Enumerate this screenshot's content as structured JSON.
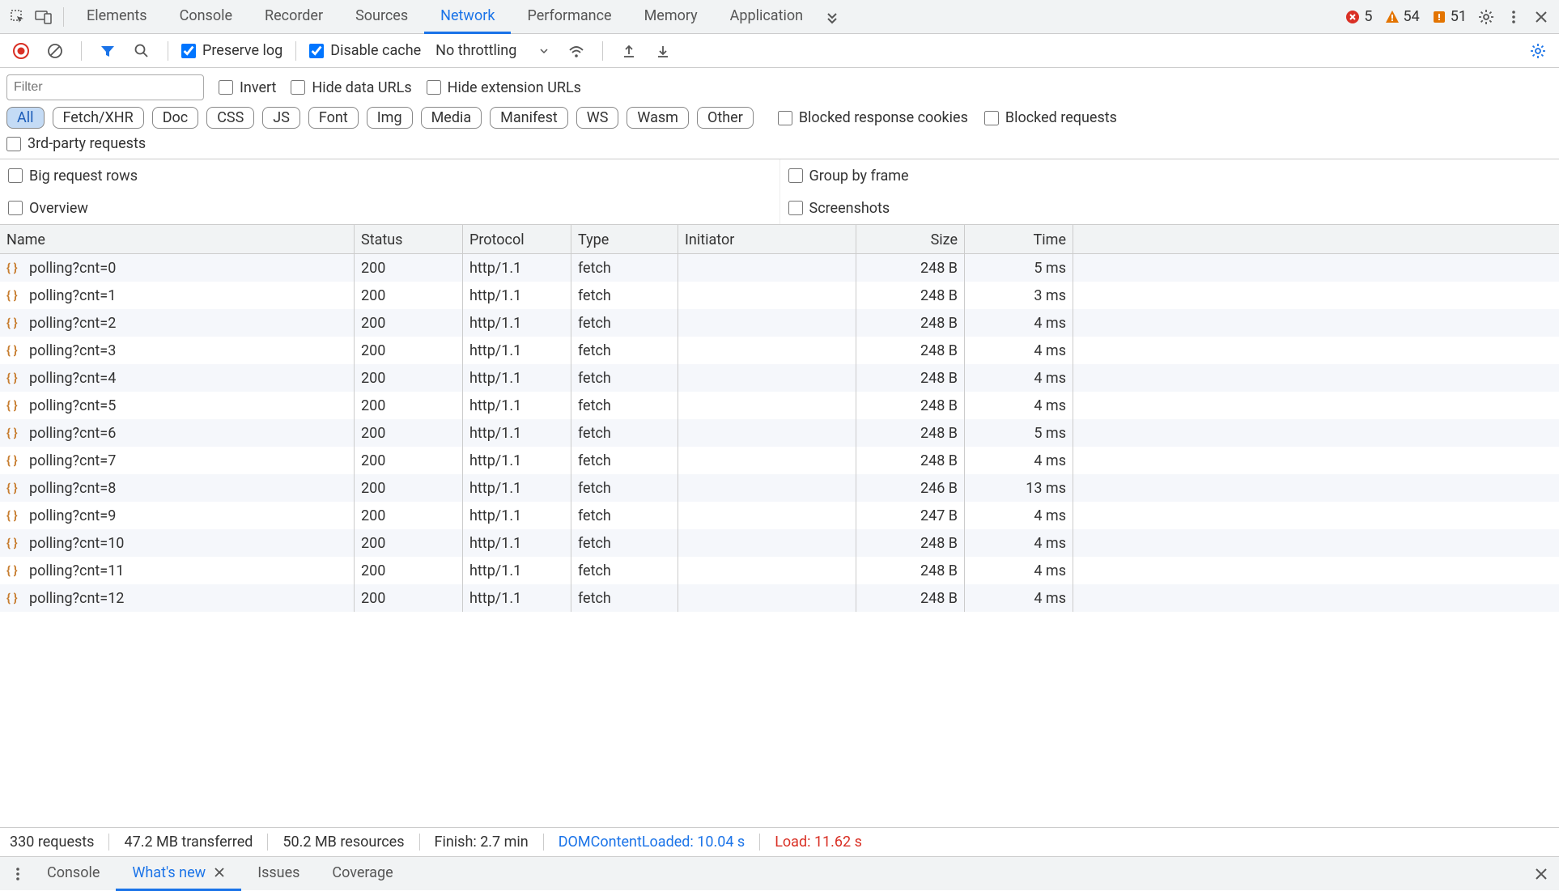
{
  "topTabs": {
    "items": [
      {
        "label": "Elements"
      },
      {
        "label": "Console"
      },
      {
        "label": "Recorder"
      },
      {
        "label": "Sources"
      },
      {
        "label": "Network",
        "active": true
      },
      {
        "label": "Performance"
      },
      {
        "label": "Memory"
      },
      {
        "label": "Application"
      }
    ]
  },
  "counters": {
    "errors": "5",
    "warnings": "54",
    "issues": "51"
  },
  "toolbar": {
    "preserve_log": "Preserve log",
    "disable_cache": "Disable cache",
    "throttling": "No throttling"
  },
  "filter": {
    "placeholder": "Filter",
    "invert": "Invert",
    "hide_data": "Hide data URLs",
    "hide_ext": "Hide extension URLs",
    "types": [
      "All",
      "Fetch/XHR",
      "Doc",
      "CSS",
      "JS",
      "Font",
      "Img",
      "Media",
      "Manifest",
      "WS",
      "Wasm",
      "Other"
    ],
    "active_type": "All",
    "blocked_cookies": "Blocked response cookies",
    "blocked_requests": "Blocked requests",
    "third_party": "3rd-party requests"
  },
  "viewOpts": {
    "big_rows": "Big request rows",
    "group_frame": "Group by frame",
    "overview": "Overview",
    "screenshots": "Screenshots"
  },
  "table": {
    "headers": {
      "name": "Name",
      "status": "Status",
      "protocol": "Protocol",
      "type": "Type",
      "initiator": "Initiator",
      "size": "Size",
      "time": "Time"
    },
    "rows": [
      {
        "name": "polling?cnt=0",
        "status": "200",
        "protocol": "http/1.1",
        "type": "fetch",
        "initiator": "",
        "size": "248 B",
        "time": "5 ms"
      },
      {
        "name": "polling?cnt=1",
        "status": "200",
        "protocol": "http/1.1",
        "type": "fetch",
        "initiator": "",
        "size": "248 B",
        "time": "3 ms"
      },
      {
        "name": "polling?cnt=2",
        "status": "200",
        "protocol": "http/1.1",
        "type": "fetch",
        "initiator": "",
        "size": "248 B",
        "time": "4 ms"
      },
      {
        "name": "polling?cnt=3",
        "status": "200",
        "protocol": "http/1.1",
        "type": "fetch",
        "initiator": "",
        "size": "248 B",
        "time": "4 ms"
      },
      {
        "name": "polling?cnt=4",
        "status": "200",
        "protocol": "http/1.1",
        "type": "fetch",
        "initiator": "",
        "size": "248 B",
        "time": "4 ms"
      },
      {
        "name": "polling?cnt=5",
        "status": "200",
        "protocol": "http/1.1",
        "type": "fetch",
        "initiator": "",
        "size": "248 B",
        "time": "4 ms"
      },
      {
        "name": "polling?cnt=6",
        "status": "200",
        "protocol": "http/1.1",
        "type": "fetch",
        "initiator": "",
        "size": "248 B",
        "time": "5 ms"
      },
      {
        "name": "polling?cnt=7",
        "status": "200",
        "protocol": "http/1.1",
        "type": "fetch",
        "initiator": "",
        "size": "248 B",
        "time": "4 ms"
      },
      {
        "name": "polling?cnt=8",
        "status": "200",
        "protocol": "http/1.1",
        "type": "fetch",
        "initiator": "",
        "size": "246 B",
        "time": "13 ms"
      },
      {
        "name": "polling?cnt=9",
        "status": "200",
        "protocol": "http/1.1",
        "type": "fetch",
        "initiator": "",
        "size": "247 B",
        "time": "4 ms"
      },
      {
        "name": "polling?cnt=10",
        "status": "200",
        "protocol": "http/1.1",
        "type": "fetch",
        "initiator": "",
        "size": "248 B",
        "time": "4 ms"
      },
      {
        "name": "polling?cnt=11",
        "status": "200",
        "protocol": "http/1.1",
        "type": "fetch",
        "initiator": "",
        "size": "248 B",
        "time": "4 ms"
      },
      {
        "name": "polling?cnt=12",
        "status": "200",
        "protocol": "http/1.1",
        "type": "fetch",
        "initiator": "",
        "size": "248 B",
        "time": "4 ms"
      }
    ]
  },
  "status": {
    "requests": "330 requests",
    "transferred": "47.2 MB transferred",
    "resources": "50.2 MB resources",
    "finish": "Finish: 2.7 min",
    "dom": "DOMContentLoaded: 10.04 s",
    "load": "Load: 11.62 s"
  },
  "drawer": {
    "console": "Console",
    "whatsnew": "What's new",
    "issues": "Issues",
    "coverage": "Coverage"
  }
}
